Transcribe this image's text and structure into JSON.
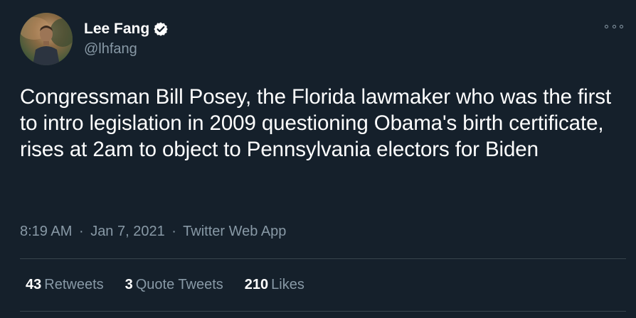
{
  "author": {
    "display_name": "Lee Fang",
    "handle": "@lhfang",
    "verified": true,
    "avatar_icon": "profile-photo"
  },
  "tweet": {
    "text": "Congressman Bill Posey, the Florida lawmaker who was the first to intro legislation in 2009 questioning Obama's birth certificate, rises at 2am to object to Pennsylvania electors for Biden",
    "time": "8:19 AM",
    "date": "Jan 7, 2021",
    "source": "Twitter Web App",
    "separator": "·"
  },
  "stats": {
    "retweets_count": "43",
    "retweets_label": "Retweets",
    "quotes_count": "3",
    "quotes_label": "Quote Tweets",
    "likes_count": "210",
    "likes_label": "Likes"
  },
  "colors": {
    "background": "#15202b",
    "primary_text": "#ffffff",
    "secondary_text": "#8899a6",
    "divider": "#38444d",
    "verified_badge": "#ffffff"
  }
}
